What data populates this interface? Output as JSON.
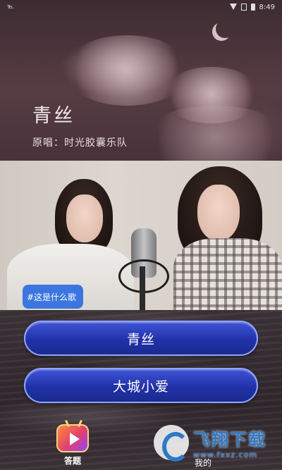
{
  "status_bar": {
    "carrier": "℡",
    "time": "8:49"
  },
  "banner": {
    "title": "青丝",
    "subtitle": "原唱：时光胶囊乐队"
  },
  "video": {
    "question": "#这是什么歌"
  },
  "answers": [
    {
      "label": "青丝"
    },
    {
      "label": "大城小爱"
    }
  ],
  "bottom_nav": {
    "quiz_label": "答题",
    "mine_label": "我的"
  },
  "watermark": {
    "name": "飞翔下载",
    "url": "www.fxxz.com"
  },
  "colors": {
    "answer_button": "#2132a8",
    "answer_border": "#8fa6ff",
    "chip": "#3b76e0"
  }
}
